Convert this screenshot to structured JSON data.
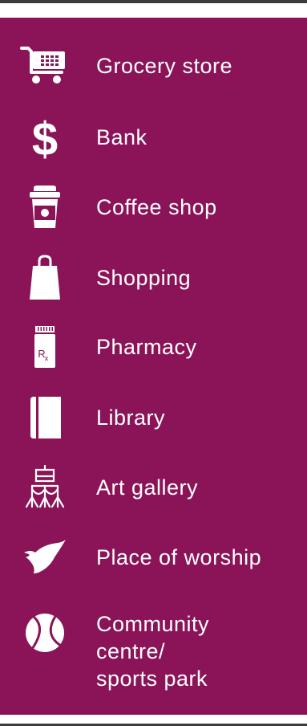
{
  "colors": {
    "panel": "#8b1459",
    "text": "#ffffff",
    "border": "#3b3b3b"
  },
  "items": [
    {
      "icon": "shopping-cart-icon",
      "label": "Grocery store"
    },
    {
      "icon": "dollar-sign-icon",
      "label": "Bank"
    },
    {
      "icon": "coffee-cup-icon",
      "label": "Coffee shop"
    },
    {
      "icon": "shopping-bag-icon",
      "label": "Shopping"
    },
    {
      "icon": "pill-bottle-icon",
      "label": "Pharmacy"
    },
    {
      "icon": "book-icon",
      "label": "Library"
    },
    {
      "icon": "easel-rope-icon",
      "label": "Art gallery"
    },
    {
      "icon": "dove-icon",
      "label": "Place of worship"
    },
    {
      "icon": "tennis-ball-icon",
      "lines": [
        "Community",
        "centre/",
        "sports park"
      ]
    }
  ]
}
